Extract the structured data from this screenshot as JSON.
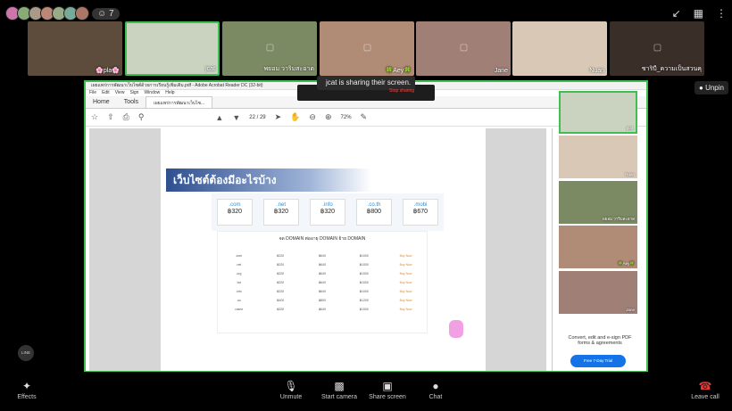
{
  "top": {
    "participant_count": "7",
    "avatars": [
      "a1",
      "a2",
      "a3",
      "a4",
      "a5",
      "a6",
      "a7"
    ]
  },
  "tiles": [
    {
      "name": "🌸pla🌸",
      "color": "#5d4b3c"
    },
    {
      "name": "jcat",
      "color": "#c9d3c0",
      "active": true
    },
    {
      "name": "พยอม วาริมสะอาด",
      "color": "#7c8a63"
    },
    {
      "name": "🍀Aey🍀",
      "color": "#b08b75"
    },
    {
      "name": "Jane",
      "color": "#a07f77"
    },
    {
      "name": "Nuan",
      "color": "#d9c8b5"
    },
    {
      "name": "ชาริบี_ความเป็นสวนคุ",
      "color": "#3a2e29"
    }
  ],
  "share": {
    "banner": "jcat is sharing their screen.",
    "stop": "Stop sharing",
    "unpin": "Unpin"
  },
  "pdf": {
    "title": "เผยแพร่การพัฒนาเว็บไซต์ด้วยการเรียนรู้เพิ่มเติม.pdf - Adobe Acrobat Reader DC (32-bit)",
    "menu": [
      "File",
      "Edit",
      "View",
      "Sign",
      "Window",
      "Help"
    ],
    "tabs": [
      "Home",
      "Tools",
      "เผยแพร่การพัฒนาเว็บไซ..."
    ],
    "page_current": "22",
    "page_total": "29",
    "zoom": "72%",
    "heading": "เว็บไซต์ต้องมีอะไรบ้าง",
    "prices": [
      {
        "tld": ".com",
        "price": "฿320"
      },
      {
        "tld": ".net",
        "price": "฿320"
      },
      {
        "tld": ".info",
        "price": "฿320"
      },
      {
        "tld": ".co.th",
        "price": "฿800"
      },
      {
        "tld": ".mobi",
        "price": "฿670"
      }
    ],
    "table_title": "จด DOMAIN ต่ออายุ DOMAIN ย้าย DOMAIN",
    "table_rows": [
      [
        ".com",
        "฿320",
        "฿640",
        "฿1000",
        "Buy Now"
      ],
      [
        ".net",
        "฿320",
        "฿640",
        "฿1000",
        "Buy Now"
      ],
      [
        ".org",
        "฿320",
        "฿640",
        "฿1000",
        "Buy Now"
      ],
      [
        ".biz",
        "฿320",
        "฿640",
        "฿1000",
        "Buy Now"
      ],
      [
        ".info",
        "฿320",
        "฿640",
        "฿1000",
        "Buy Now"
      ],
      [
        ".us",
        "฿400",
        "฿800",
        "฿1200",
        "Buy Now"
      ],
      [
        ".name",
        "฿320",
        "฿640",
        "฿1000",
        "Buy Now"
      ]
    ],
    "promo_text": "Convert, edit and e-sign PDF forms & agreements",
    "promo_button": "Free 7-Day Trial"
  },
  "gallery": [
    {
      "name": "jcat",
      "color": "#c9d3c0",
      "active": true
    },
    {
      "name": "Nuan",
      "color": "#d9c8b5"
    },
    {
      "name": "พยอม วาริมสะอาด",
      "color": "#7c8a63"
    },
    {
      "name": "🍀Aey🍀",
      "color": "#b08b75"
    },
    {
      "name": "Jane",
      "color": "#a07f77"
    }
  ],
  "controls": {
    "effects": "Effects",
    "unmute": "Unmute",
    "start_camera": "Start camera",
    "share_screen": "Share screen",
    "chat": "Chat",
    "leave": "Leave call",
    "line_logo": "LINE"
  }
}
